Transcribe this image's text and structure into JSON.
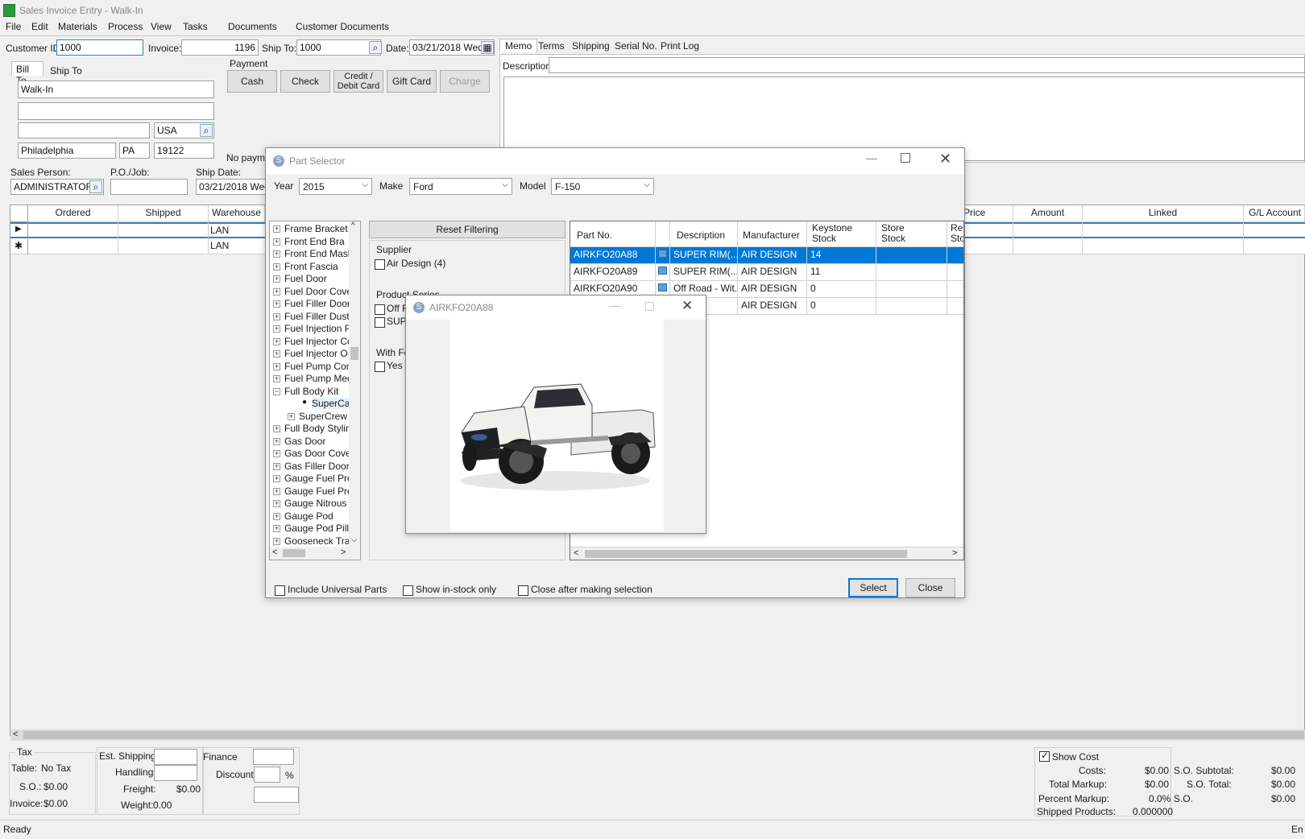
{
  "window": {
    "title": "Sales Invoice Entry - Walk-In"
  },
  "menu": [
    "File",
    "Edit",
    "Materials",
    "Process",
    "View",
    "Tasks",
    "Documents",
    "Customer Documents"
  ],
  "header": {
    "customer_id_label": "Customer ID:",
    "customer_id": "1000",
    "invoice_label": "Invoice:",
    "invoice": "1196",
    "ship_to_label": "Ship To:",
    "ship_to": "1000",
    "date_label": "Date:",
    "date": "03/21/2018 Wed"
  },
  "address_tabs": [
    "Bill To",
    "Ship To"
  ],
  "address": {
    "name": "Walk-In",
    "line2": "",
    "line3": "",
    "country": "USA",
    "city": "Philadelphia",
    "state": "PA",
    "zip": "19122"
  },
  "payment": {
    "label": "Payment",
    "buttons": [
      "Cash",
      "Check",
      "Credit /\nDebit Card",
      "Gift Card",
      "Charge"
    ],
    "note": "No payme"
  },
  "sales": {
    "person_label": "Sales Person:",
    "person": "ADMINISTRATOR",
    "po_label": "P.O./Job:",
    "po": "",
    "ship_date_label": "Ship Date:",
    "ship_date": "03/21/2018 Wed"
  },
  "memo_tabs": [
    "Memo",
    "Terms",
    "Shipping",
    "Serial No.",
    "Print Log"
  ],
  "memo": {
    "description_label": "Description:"
  },
  "lines_grid": {
    "left_cols": [
      "Ordered",
      "Shipped",
      "Warehouse"
    ],
    "right_cols": [
      "Price",
      "Amount",
      "Linked",
      "G/L Account"
    ],
    "rows": [
      {
        "marker": "▶",
        "warehouse": "LAN"
      },
      {
        "marker": "✱",
        "warehouse": "LAN"
      }
    ]
  },
  "totals": {
    "tax_label": "Tax",
    "table_label": "Table:",
    "table_value": "No Tax",
    "so_label": "S.O.:",
    "so_value": "$0.00",
    "invoice_label": "Invoice:",
    "invoice_value": "$0.00",
    "est_shipping_label": "Est. Shipping:",
    "handling_label": "Handling:",
    "freight_label": "Freight:",
    "freight_value": "$0.00",
    "weight_label": "Weight:",
    "weight_value": "0.00",
    "finance_label": "Finance",
    "discount_label": "Discount:",
    "percent": "%",
    "show_cost_label": "Show Cost",
    "costs_label": "Costs:",
    "costs": "$0.00",
    "total_markup_label": "Total Markup:",
    "total_markup": "$0.00",
    "percent_markup_label": "Percent Markup:",
    "percent_markup": "0.0%",
    "shipped_products_label": "Shipped Products:",
    "shipped_products": "0.000000",
    "so_subtotal_label": "S.O. Subtotal:",
    "so_subtotal": "$0.00",
    "so_total_label": "S.O. Total:",
    "so_total": "$0.00",
    "so2_label": "S.O.",
    "so2": "$0.00"
  },
  "status": {
    "text": "Ready",
    "right": "En"
  },
  "part_selector": {
    "title": "Part Selector",
    "year_label": "Year",
    "year": "2015",
    "make_label": "Make",
    "make": "Ford",
    "model_label": "Model",
    "model": "F-150",
    "tree": [
      {
        "label": "Frame Bracket - F",
        "exp": "+"
      },
      {
        "label": "Front End Bra",
        "exp": "+"
      },
      {
        "label": "Front End Mask",
        "exp": "+"
      },
      {
        "label": "Front Fascia",
        "exp": "+"
      },
      {
        "label": "Fuel Door",
        "exp": "+"
      },
      {
        "label": "Fuel Door Cover",
        "exp": "+"
      },
      {
        "label": "Fuel Filler Door",
        "exp": "+"
      },
      {
        "label": "Fuel Filler Dust C",
        "exp": "+"
      },
      {
        "label": "Fuel Injection Pu",
        "exp": "+"
      },
      {
        "label": "Fuel Injector Cor",
        "exp": "+"
      },
      {
        "label": "Fuel Injector O-R",
        "exp": "+"
      },
      {
        "label": "Fuel Pump Contr",
        "exp": "+"
      },
      {
        "label": "Fuel Pump Mech",
        "exp": "+"
      },
      {
        "label": "Full Body Kit",
        "exp": "-"
      },
      {
        "label": "SuperCab",
        "exp": "•"
      },
      {
        "label": "SuperCrew",
        "exp": "+"
      },
      {
        "label": "Full Body Styling",
        "exp": "+"
      },
      {
        "label": "Gas Door",
        "exp": "+"
      },
      {
        "label": "Gas Door Cover",
        "exp": "+"
      },
      {
        "label": "Gas Filler Door",
        "exp": "+"
      },
      {
        "label": "Gauge Fuel Pres",
        "exp": "+"
      },
      {
        "label": "Gauge Fuel Pres",
        "exp": "+"
      },
      {
        "label": "Gauge Nitrous O",
        "exp": "+"
      },
      {
        "label": "Gauge Pod",
        "exp": "+"
      },
      {
        "label": "Gauge Pod Pillar",
        "exp": "+"
      },
      {
        "label": "Gooseneck Trail",
        "exp": "+"
      }
    ],
    "reset_filtering": "Reset Filtering",
    "supplier_label": "Supplier",
    "supplier_option": "Air Design (4)",
    "product_series_label": "Product Series",
    "series_options": [
      "Off R",
      "SUP"
    ],
    "with_label": "With Fe",
    "with_option": "Yes (",
    "grid_headers": [
      "Part No.",
      "",
      "Description",
      "Manufacturer",
      "Keystone\nStock",
      "Store\nStock",
      "Ret\nSto"
    ],
    "grid_rows": [
      {
        "part": "AIRKFO20A88",
        "desc": "SUPER RIM(...",
        "mfr": "AIR DESIGN",
        "ks": "14",
        "selected": true
      },
      {
        "part": "AIRKFO20A89",
        "desc": "SUPER RIM(...",
        "mfr": "AIR DESIGN",
        "ks": "11",
        "selected": false
      },
      {
        "part": "AIRKFO20A90",
        "desc": "Off Road - Wit...",
        "mfr": "AIR DESIGN",
        "ks": "0",
        "selected": false
      },
      {
        "part": "",
        "desc": "- Wit...",
        "mfr": "AIR DESIGN",
        "ks": "0",
        "selected": false
      }
    ],
    "include_universal": "Include Universal Parts",
    "in_stock_only": "Show in-stock only",
    "close_after": "Close after making selection",
    "select_button": "Select",
    "close_button": "Close"
  },
  "image_popup": {
    "title": "AIRKFO20A88"
  },
  "colors": {
    "selection": "#0078d7",
    "accent_border": "#3c7fb1"
  }
}
